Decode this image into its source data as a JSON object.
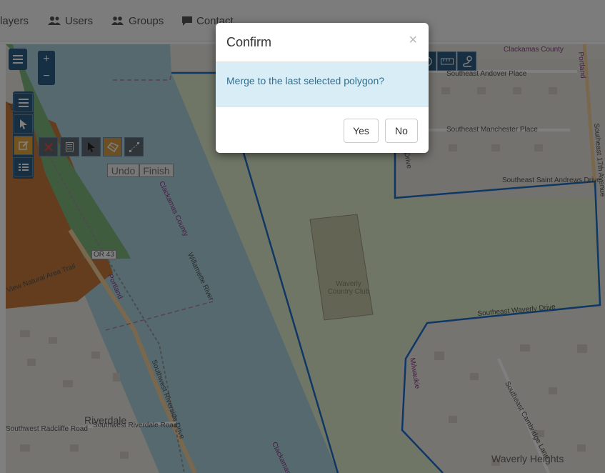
{
  "nav": {
    "items": [
      {
        "label": "layers",
        "icon": "layers-icon"
      },
      {
        "label": "Users",
        "icon": "users-icon"
      },
      {
        "label": "Groups",
        "icon": "groups-icon"
      },
      {
        "label": "Contact",
        "icon": "comment-icon"
      }
    ]
  },
  "map": {
    "zoom_in": "+",
    "zoom_out": "−",
    "undo_label": "Undo",
    "finish_label": "Finish",
    "labels": {
      "clackamas_county_top": "Clackamas County",
      "clackamas_county_river": "Clackamas County",
      "clackamas_bottom": "Clackamas",
      "andover": "Southeast Andover Place",
      "manchester": "Southeast Manchester Place",
      "saint_andrews": "Southeast Saint Andrews Drive",
      "drive": "Drive",
      "se_17th": "Southeast 17th Avenue",
      "portland_top": "Portland",
      "portland_left": "Portland",
      "willamette": "Willamette River",
      "waverly_club": "Waverly Country Club",
      "or43": "OR 43",
      "natural_area": "View Natural Area Trail",
      "avenue": "Avenue",
      "riverdale": "Riverdale",
      "radcliffe": "Southwest Radcliffe Road",
      "riverdale_road": "Southwest Riverdale Road",
      "riverside": "Southwest Riverside Drive",
      "milwaukie": "Milwaukie",
      "cambridge": "Southeast Cambridge Lane",
      "waverly_heights": "Waverly Heights",
      "waverly_drive": "Southeast Waverly Drive"
    }
  },
  "modal": {
    "title": "Confirm",
    "close": "×",
    "message": "Merge to the last selected polygon?",
    "yes": "Yes",
    "no": "No"
  },
  "colors": {
    "river": "#aad3df",
    "golf": "#dfeccd",
    "polygon_stroke": "#1e6fc8",
    "nature": "#c77a3a"
  }
}
